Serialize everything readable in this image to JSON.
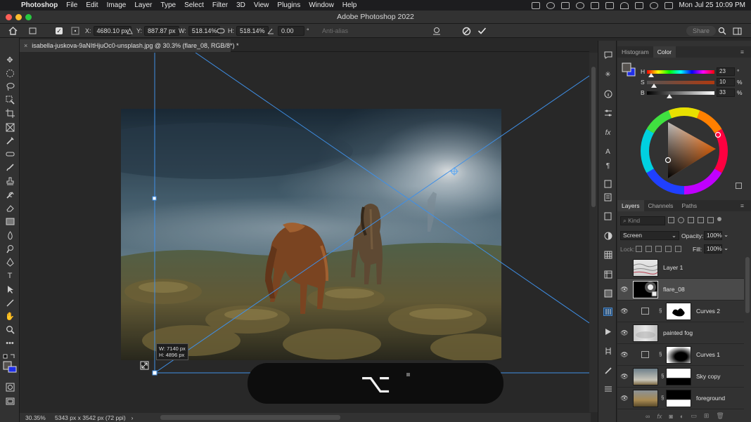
{
  "menubar": {
    "app": "Photoshop",
    "items": [
      "File",
      "Edit",
      "Image",
      "Layer",
      "Type",
      "Select",
      "Filter",
      "3D",
      "View",
      "Plugins",
      "Window",
      "Help"
    ],
    "datetime": "Mon Jul 25  10:09 PM"
  },
  "window": {
    "title": "Adobe Photoshop 2022"
  },
  "options": {
    "x_label": "X:",
    "x": "4680.10 px",
    "y_label": "Y:",
    "y": "887.87 px",
    "w_label": "W:",
    "w": "518.14%",
    "h_label": "H:",
    "h": "518.14%",
    "angle": "0.00",
    "angle_unit": "°",
    "antialias": "Anti-alias",
    "share": "Share"
  },
  "document": {
    "tab_title": "isabella-juskova-9aNItHjuOc0-unsplash.jpg @ 30.3% (flare_08, RGB/8*) *",
    "transform_readout_w": "W: 7140 px",
    "transform_readout_h": "H: 4896 px"
  },
  "status": {
    "zoom": "30.35%",
    "info": "5343 px x 3542 px (72 ppi)",
    "arrow": "›"
  },
  "color_panel": {
    "tabs": [
      "Histogram",
      "Color"
    ],
    "active_tab": "Color",
    "h_label": "H",
    "h_value": "23",
    "h_unit": "°",
    "h_fraction": 0.064,
    "s_label": "S",
    "s_value": "10",
    "s_unit": "%",
    "s_fraction": 0.1,
    "b_label": "B",
    "b_value": "33",
    "b_unit": "%",
    "b_fraction": 0.33,
    "foreground": "#55514e",
    "background": "#1f2fe8"
  },
  "layers_panel": {
    "tabs": [
      "Layers",
      "Channels",
      "Paths"
    ],
    "active_tab": "Layers",
    "kind_placeholder": "Kind",
    "blend_mode": "Screen",
    "opacity_label": "Opacity:",
    "opacity": "100%",
    "lock_label": "Lock:",
    "fill_label": "Fill:",
    "fill": "100%",
    "layers": [
      {
        "name": "Layer 1",
        "visible": false,
        "selected": false,
        "type": "pixel"
      },
      {
        "name": "flare_08",
        "visible": true,
        "selected": true,
        "type": "pixel"
      },
      {
        "name": "Curves 2",
        "visible": true,
        "selected": false,
        "type": "adjustment"
      },
      {
        "name": "painted fog",
        "visible": true,
        "selected": false,
        "type": "pixel"
      },
      {
        "name": "Curves 1",
        "visible": true,
        "selected": false,
        "type": "adjustment"
      },
      {
        "name": "Sky copy",
        "visible": true,
        "selected": false,
        "type": "masked"
      },
      {
        "name": "foreground",
        "visible": true,
        "selected": false,
        "type": "masked"
      }
    ]
  },
  "hud": {
    "symbol": "⌥"
  }
}
